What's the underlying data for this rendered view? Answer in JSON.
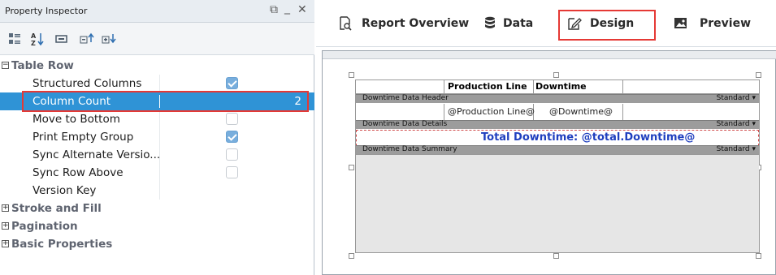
{
  "inspector": {
    "title": "Property Inspector",
    "window_controls": {
      "restore": "⧉",
      "minimize": "_",
      "close": "✕"
    },
    "toolbar_icons": [
      "categorized-icon",
      "sort-az-icon",
      "description-icon",
      "expand-all-icon",
      "collapse-all-icon"
    ],
    "groups": [
      {
        "label": "Table Row",
        "expanded": true,
        "symbol": "−"
      },
      {
        "label": "Stroke and Fill",
        "expanded": false,
        "symbol": "+"
      },
      {
        "label": "Pagination",
        "expanded": false,
        "symbol": "+"
      },
      {
        "label": "Basic Properties",
        "expanded": false,
        "symbol": "+"
      }
    ],
    "properties": [
      {
        "label": "Structured Columns",
        "checked": true
      },
      {
        "label": "Column Count",
        "value": "2",
        "selected": true
      },
      {
        "label": "Move to Bottom",
        "checked": false
      },
      {
        "label": "Print Empty Group",
        "checked": true
      },
      {
        "label": "Sync Alternate Versio...",
        "checked": false
      },
      {
        "label": "Sync Row Above",
        "checked": false
      },
      {
        "label": "Version Key"
      }
    ]
  },
  "tabs": [
    {
      "label": "Report Overview",
      "icon": "magnify-document-icon"
    },
    {
      "label": "Data",
      "icon": "database-icon"
    },
    {
      "label": "Design",
      "icon": "design-edit-icon",
      "active": true
    },
    {
      "label": "Preview",
      "icon": "image-icon"
    }
  ],
  "design": {
    "header_columns": [
      "Production Line",
      "Downtime"
    ],
    "bands": {
      "header": {
        "label": "Downtime Data Header",
        "mode": "Standard ▾"
      },
      "details": {
        "label": "Downtime Data Details",
        "mode": "Standard ▾"
      },
      "summary": {
        "label": "Downtime Data Summary",
        "mode": "Standard ▾"
      }
    },
    "detail_fields": [
      "@Production Line@",
      "@Downtime@"
    ],
    "summary_text": "Total Downtime: @total.Downtime@"
  },
  "colors": {
    "selection": "#2f93d6",
    "highlight": "#e53935",
    "summary_text": "#1f3fbf",
    "checkbox_on": "#78aedd"
  }
}
